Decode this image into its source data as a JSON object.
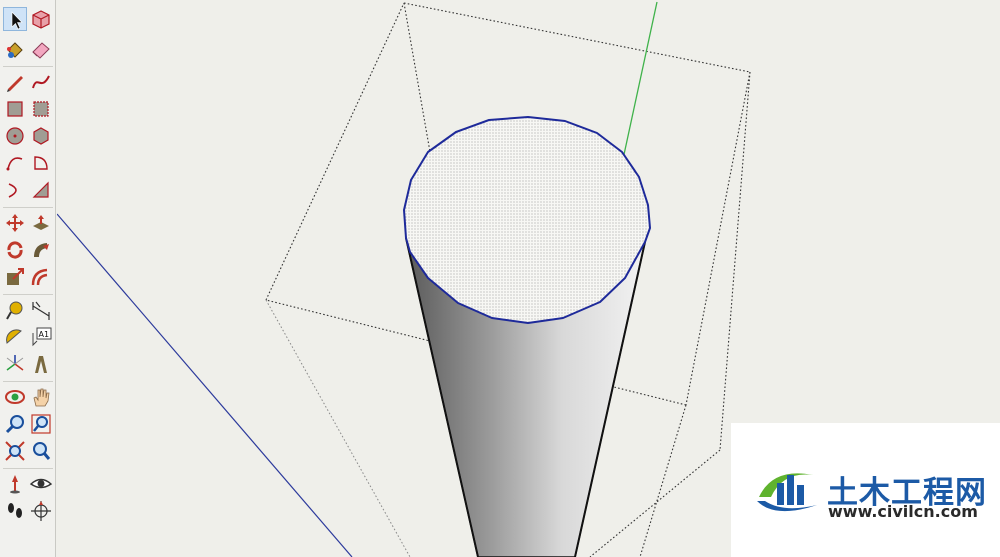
{
  "toolbar": {
    "tools": [
      "select-tool",
      "make-component-tool",
      "paint-bucket-tool",
      "eraser-tool",
      "line-tool",
      "freehand-tool",
      "rectangle-tool",
      "rotated-rectangle-tool",
      "circle-tool",
      "polygon-tool",
      "arc-tool",
      "pie-tool",
      "two-point-arc-tool",
      "three-point-arc-tool",
      "move-tool",
      "push-pull-tool",
      "rotate-tool",
      "follow-me-tool",
      "scale-tool",
      "offset-tool",
      "tape-measure-tool",
      "dimension-tool",
      "protractor-tool",
      "text-tool",
      "axes-tool",
      "3d-text-tool",
      "orbit-tool",
      "pan-tool",
      "zoom-tool",
      "zoom-window-tool",
      "zoom-extents-tool",
      "previous-view-tool",
      "position-camera-tool",
      "look-around-tool",
      "walk-tool",
      "section-plane-tool"
    ],
    "text_tool_badge": "A1",
    "active_tool": "select-tool"
  },
  "watermark": {
    "title": "土木工程网",
    "url": "www.civilcn.com"
  },
  "colors": {
    "background": "#efefea",
    "edge_selected": "#1e2a9a",
    "green_axis": "#3fb24a",
    "blue_axis": "#2c3a9c",
    "brand_blue": "#1c5aa6",
    "brand_green": "#5fb32e"
  }
}
